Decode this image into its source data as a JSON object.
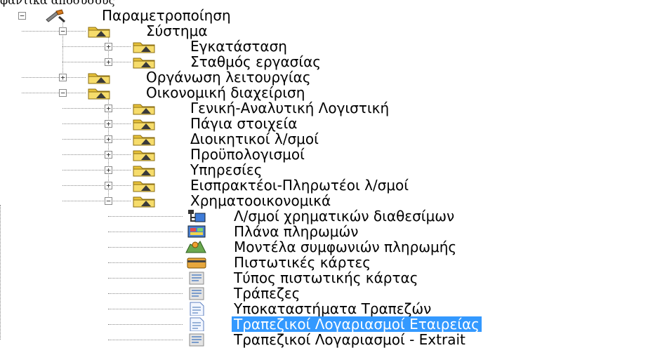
{
  "top_text": "φαντικά αποσύσους",
  "tree": [
    {
      "label": "Παραμετροποίηση",
      "icon": "tools-icon",
      "expander": "−"
    },
    {
      "label": "Σύστημα",
      "icon": "folder-icon",
      "expander": "−"
    },
    {
      "label": "Εγκατάσταση",
      "icon": "folder-icon",
      "expander": "+"
    },
    {
      "label": "Σταθμός εργασίας",
      "icon": "folder-icon",
      "expander": "+"
    },
    {
      "label": "Οργάνωση λειτουργίας",
      "icon": "folder-icon",
      "expander": "+"
    },
    {
      "label": "Οικονομική διαχείριση",
      "icon": "folder-icon",
      "expander": "−"
    },
    {
      "label": "Γενική-Αναλυτική Λογιστική",
      "icon": "folder-icon",
      "expander": "+"
    },
    {
      "label": "Πάγια στοιχεία",
      "icon": "folder-icon",
      "expander": "+"
    },
    {
      "label": "Διοικητικοί λ/σμοί",
      "icon": "folder-icon",
      "expander": "+"
    },
    {
      "label": "Προϋπολογισμοί",
      "icon": "folder-icon",
      "expander": "+"
    },
    {
      "label": "Υπηρεσίες",
      "icon": "folder-icon",
      "expander": "+"
    },
    {
      "label": "Εισπρακτέοι-Πληρωτέοι λ/σμοί",
      "icon": "folder-icon",
      "expander": "+"
    },
    {
      "label": "Χρηματοοικονομικά",
      "icon": "folder-icon",
      "expander": "−"
    },
    {
      "label": "Λ/σμοί χρηματικών διαθεσίμων",
      "icon": "accounts-tree-icon"
    },
    {
      "label": "Πλάνα πληρωμών",
      "icon": "payment-plan-icon"
    },
    {
      "label": "Μοντέλα συμφωνιών πληρωμής",
      "icon": "payment-model-icon"
    },
    {
      "label": "Πιστωτικές κάρτες",
      "icon": "credit-card-icon"
    },
    {
      "label": "Τύπος πιστωτικής κάρτας",
      "icon": "list-form-icon"
    },
    {
      "label": "Τράπεζες",
      "icon": "list-form-icon"
    },
    {
      "label": "Υποκαταστήματα Τραπεζών",
      "icon": "document-icon"
    },
    {
      "label": "Τραπεζικοί Λογαριασμοί Εταιρείας",
      "icon": "document-icon",
      "selected": true
    },
    {
      "label": "Τραπεζικοί Λογαριασμοί - Extrait",
      "icon": "list-form-icon"
    }
  ]
}
